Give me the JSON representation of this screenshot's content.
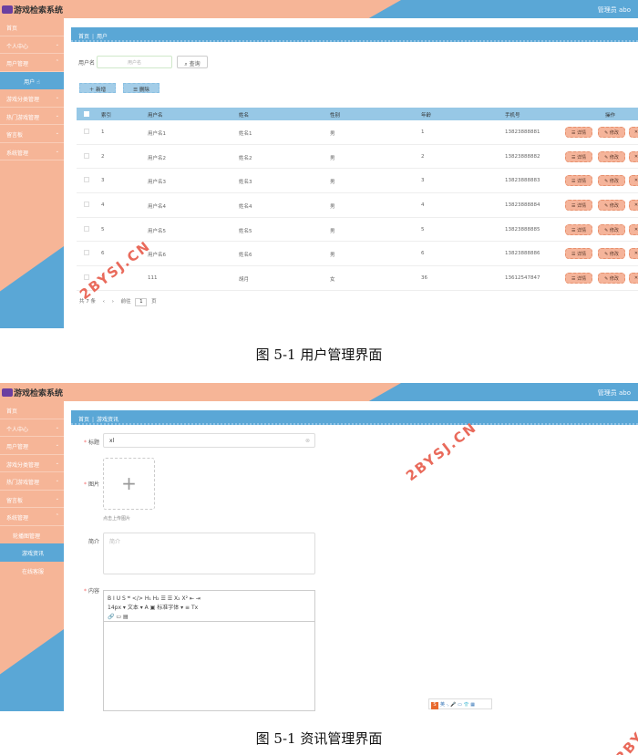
{
  "app": {
    "title": "游戏检索系统",
    "admin_label": "管理员 abo"
  },
  "shot1": {
    "menu": [
      "首页",
      "个人中心",
      "用户管理",
      "用户",
      "游戏分类管理",
      "热门游戏管理",
      "留言板",
      "系统管理"
    ],
    "breadcrumb": [
      "首页",
      "用户"
    ],
    "search": {
      "label": "用户名",
      "placeholder": "用户名",
      "button": "查询"
    },
    "toolbar": {
      "add": "新增",
      "delete": "删除"
    },
    "table": {
      "headers": [
        "索引",
        "用户名",
        "姓名",
        "性别",
        "年龄",
        "手机号",
        "操作"
      ],
      "rows": [
        [
          "1",
          "用户名1",
          "姓名1",
          "男",
          "1",
          "13823888881"
        ],
        [
          "2",
          "用户名2",
          "姓名2",
          "男",
          "2",
          "13823888882"
        ],
        [
          "3",
          "用户名3",
          "姓名3",
          "男",
          "3",
          "13823888883"
        ],
        [
          "4",
          "用户名4",
          "姓名4",
          "男",
          "4",
          "13823888884"
        ],
        [
          "5",
          "用户名5",
          "姓名5",
          "男",
          "5",
          "13823888885"
        ],
        [
          "6",
          "用户名6",
          "姓名6",
          "男",
          "6",
          "13823888886"
        ],
        [
          "7",
          "111",
          "胡月",
          "女",
          "36",
          "13612547847"
        ]
      ],
      "ops": [
        "详情",
        "修改",
        "删除"
      ]
    },
    "pager": {
      "total": "共 7 条",
      "goto": "前往",
      "page": "1",
      "unit": "页"
    },
    "caption": "图 5-1  用户管理界面"
  },
  "shot2": {
    "menu": [
      "首页",
      "个人中心",
      "用户管理",
      "游戏分类管理",
      "热门游戏管理",
      "留言板",
      "系统管理",
      "轮播图管理",
      "游戏资讯",
      "在线客服"
    ],
    "breadcrumb": [
      "首页",
      "游戏资讯"
    ],
    "form": {
      "title_label": "标题",
      "title_value": "xl",
      "image_label": "图片",
      "upload_tip": "点击上传图片",
      "intro_label": "简介",
      "intro_placeholder": "简介",
      "content_label": "内容",
      "editor_row1": "B  I  U  S   ❝  </>   H₁  H₂   ☰  ☰   X₂  X²   ⇤  ⇥",
      "editor_row2": "14px ▾   文本 ▾   A  ▣   标准字体 ▾   ≡  Tx",
      "editor_row3": "🔗  ▭  ▤"
    },
    "ime": "英 ·, 🎤 ▭ 👕 ▦",
    "caption": "图 5-1  资讯管理界面"
  },
  "watermark": "2BYSJ.CN",
  "colors": {
    "salmon": "#f6b597",
    "blue": "#5aa7d6",
    "header_row": "#97c8e6",
    "op_button": "#f5b49a",
    "watermark": "#e96a5b"
  }
}
